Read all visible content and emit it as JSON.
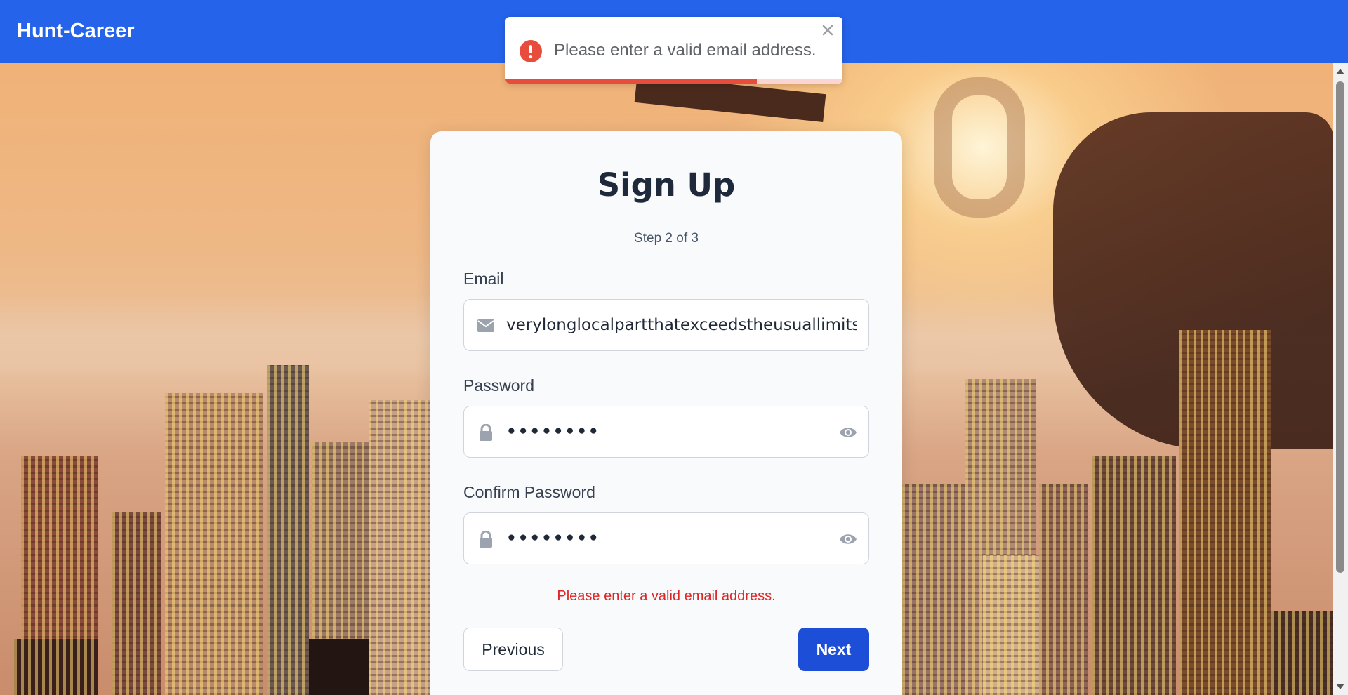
{
  "header": {
    "brand": "Hunt-Career"
  },
  "toast": {
    "message": "Please enter a valid email address.",
    "type": "error",
    "icon": "error-circle-icon",
    "progress": 0.745,
    "accent_color": "#e74c3c"
  },
  "form": {
    "title": "Sign Up",
    "step": "Step 2 of 3",
    "email": {
      "label": "Email",
      "value": "verylonglocalpartthatexceedstheusuallimitstove",
      "icon": "envelope-icon"
    },
    "password": {
      "label": "Password",
      "value": "••••••••",
      "icon": "lock-icon",
      "toggle_icon": "eye-icon"
    },
    "confirm_password": {
      "label": "Confirm Password",
      "value": "••••••••",
      "icon": "lock-icon",
      "toggle_icon": "eye-icon"
    },
    "error": "Please enter a valid email address.",
    "prev_label": "Previous",
    "next_label": "Next"
  },
  "colors": {
    "header": "#2563eb",
    "primary_button": "#1d4ed8",
    "error_text": "#dc2626"
  }
}
